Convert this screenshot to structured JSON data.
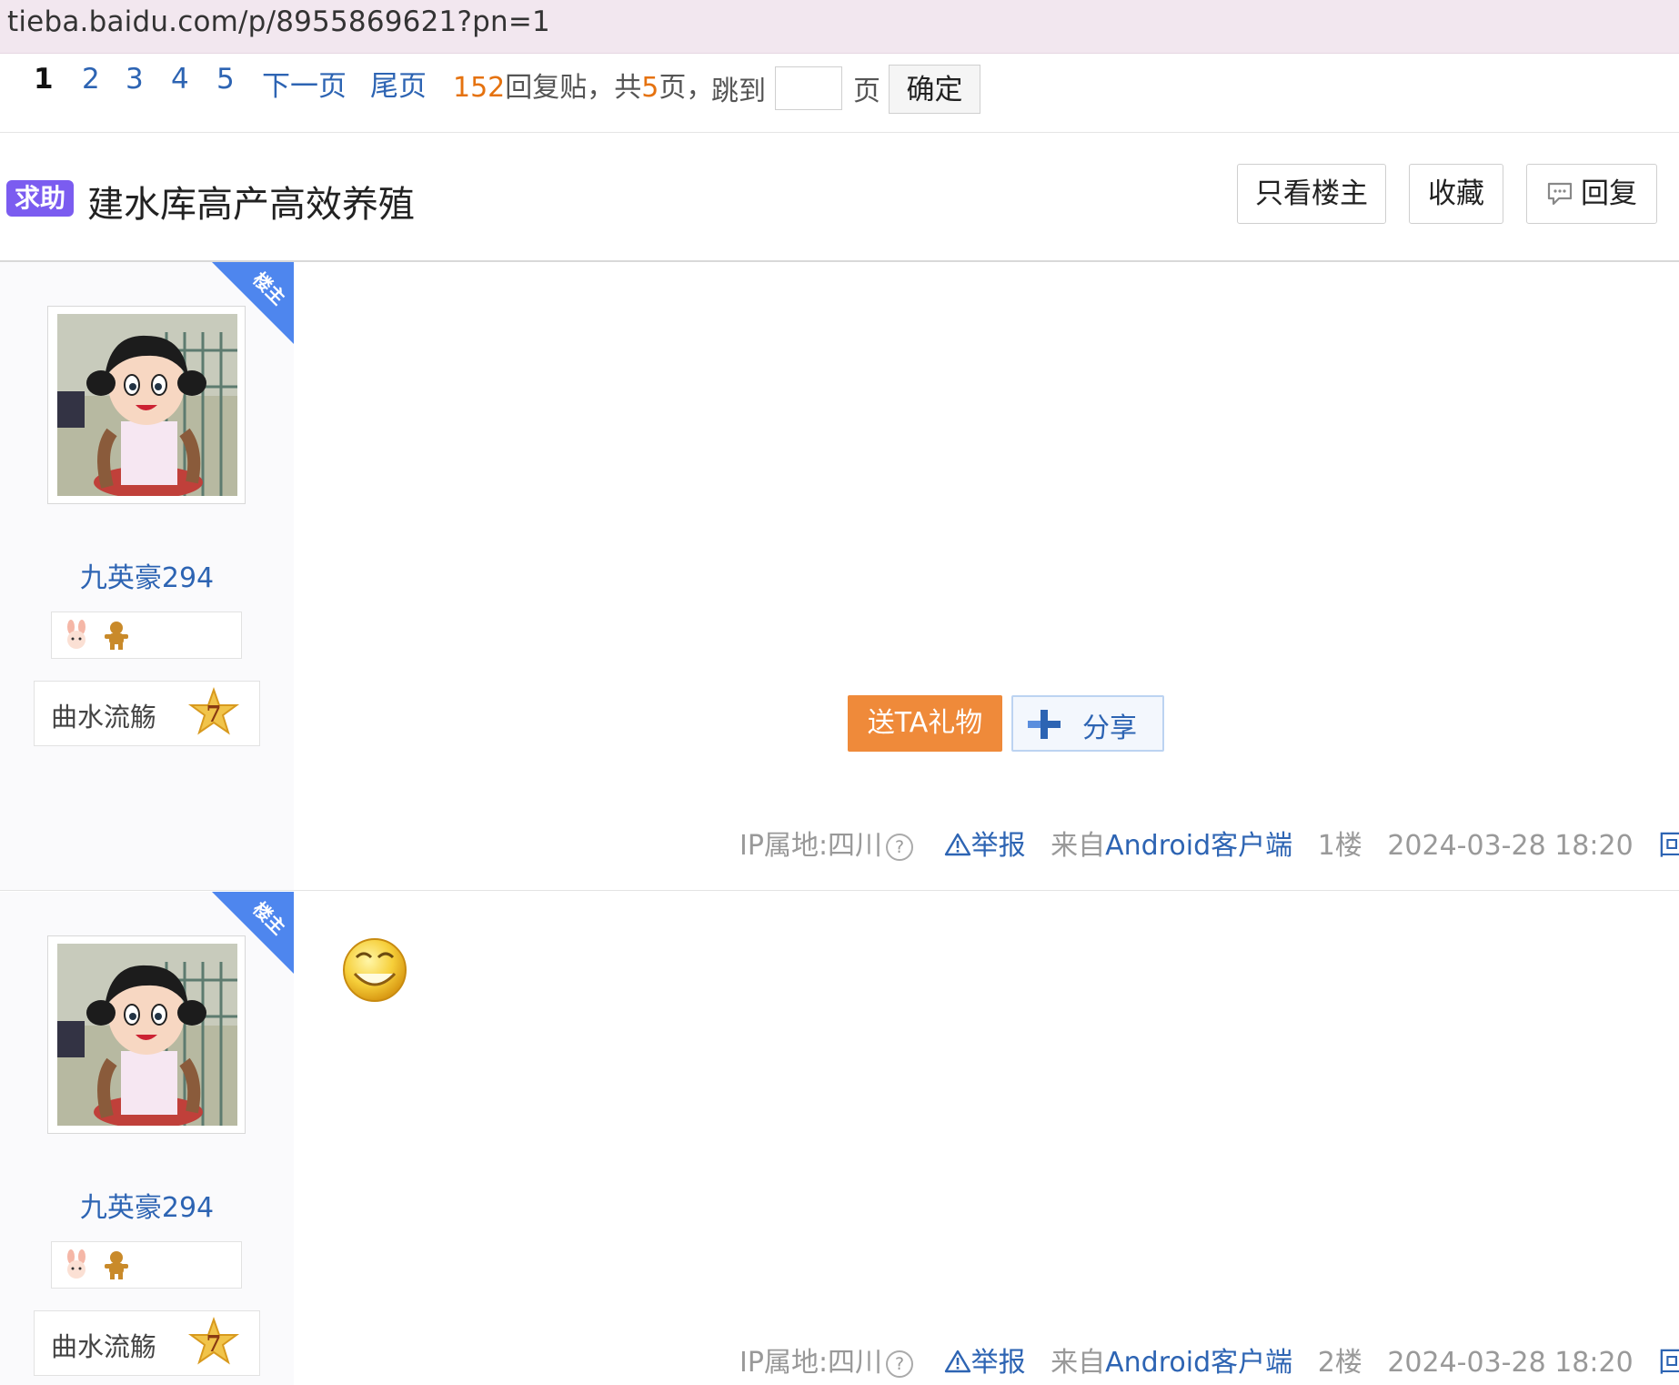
{
  "browser": {
    "url": "tieba.baidu.com/p/8955869621?pn=1"
  },
  "pager": {
    "current": "1",
    "pages": [
      "2",
      "3",
      "4",
      "5"
    ],
    "next_label": "下一页",
    "last_label": "尾页",
    "reply_count": "152",
    "reply_label": "回复贴，共",
    "total_pages": "5",
    "page_suffix": "页，",
    "jump_label": "跳到",
    "page_unit": "页",
    "confirm_label": "确定"
  },
  "thread": {
    "badge": "求助",
    "title": "建水库高产高效养殖",
    "buttons": {
      "only_op": "只看楼主",
      "favorite": "收藏",
      "reply": "回复"
    }
  },
  "posts": [
    {
      "username": "九英豪294",
      "level_name": "曲水流觞",
      "level": "7",
      "corner_tag": "楼主",
      "gift_label": "送TA礼物",
      "share_label": "分享",
      "ip": "IP属地:四川",
      "report": "举报",
      "from_prefix": "来自",
      "client": "Android客户端",
      "floor": "1楼",
      "time": "2024-03-28 18:20",
      "reply": "回复"
    },
    {
      "username": "九英豪294",
      "level_name": "曲水流觞",
      "level": "7",
      "corner_tag": "楼主",
      "ip": "IP属地:四川",
      "report": "举报",
      "from_prefix": "来自",
      "client": "Android客户端",
      "floor": "2楼",
      "time": "2024-03-28 18:20",
      "reply": "回复"
    }
  ],
  "colors": {
    "link": "#2d64b3",
    "badge": "#7b5cf0",
    "gift": "#ef8a3a",
    "corner": "#4e86ee"
  }
}
